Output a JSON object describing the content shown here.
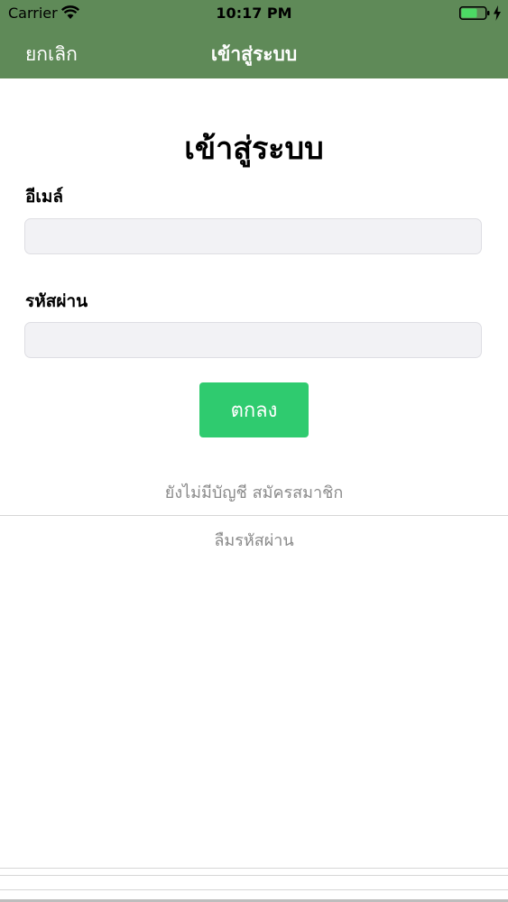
{
  "status_bar": {
    "carrier": "Carrier",
    "time": "10:17 PM",
    "icons": [
      "wifi-icon",
      "battery-icon",
      "charging-bolt-icon"
    ]
  },
  "nav": {
    "cancel_label": "ยกเลิก",
    "title": "เข้าสู่ระบบ"
  },
  "form": {
    "title": "เข้าสู่ระบบ",
    "email_label": "อีเมล์",
    "email_value": "",
    "password_label": "รหัสผ่าน",
    "password_value": "",
    "submit_label": "ตกลง",
    "register_link": "ยังไม่มีบัญชี สมัครสมาชิก",
    "forgot_link": "ลืมรหัสผ่าน"
  },
  "colors": {
    "nav_background": "#5f8a58",
    "button_green": "#2fcb6f",
    "input_background": "#f2f2f5",
    "link_gray": "#8a8a8a"
  }
}
